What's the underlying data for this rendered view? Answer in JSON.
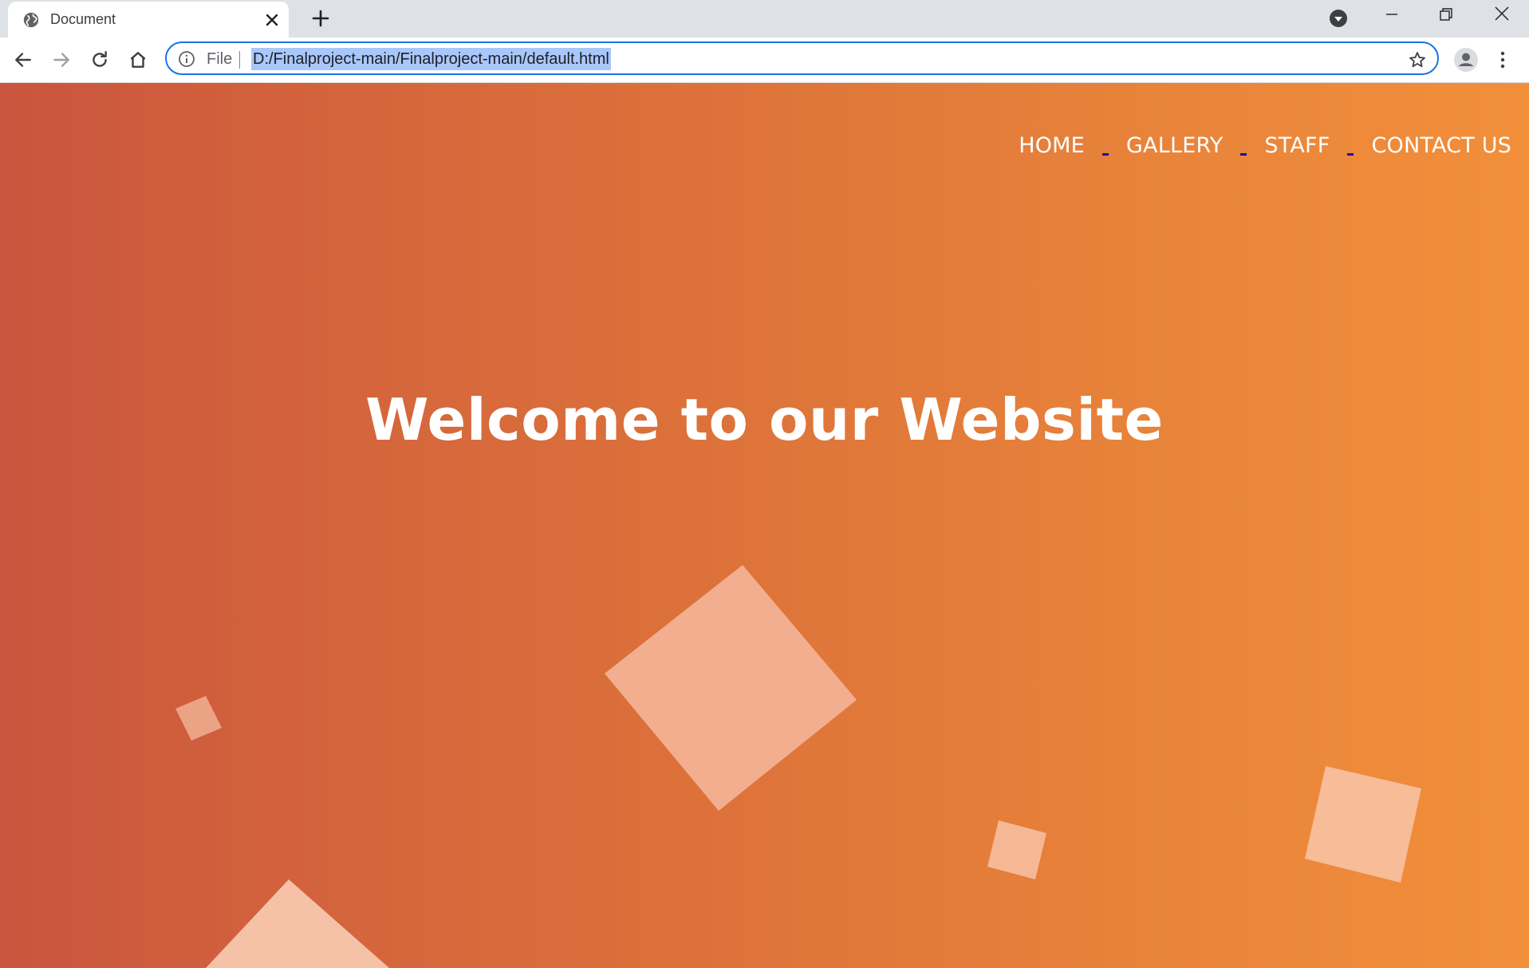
{
  "browser": {
    "tab_title": "Document",
    "url_scheme": "File",
    "url": "D:/Finalproject-main/Finalproject-main/default.html"
  },
  "site": {
    "nav": [
      "HOME",
      "GALLERY",
      "STAFF",
      "CONTACT US"
    ],
    "hero_title": "Welcome to our Website"
  },
  "colors": {
    "gradient_start": "#c9553e",
    "gradient_end": "#f28f3a",
    "omnibox_focus": "#1a73e8",
    "url_selection": "#a8c7fa"
  }
}
